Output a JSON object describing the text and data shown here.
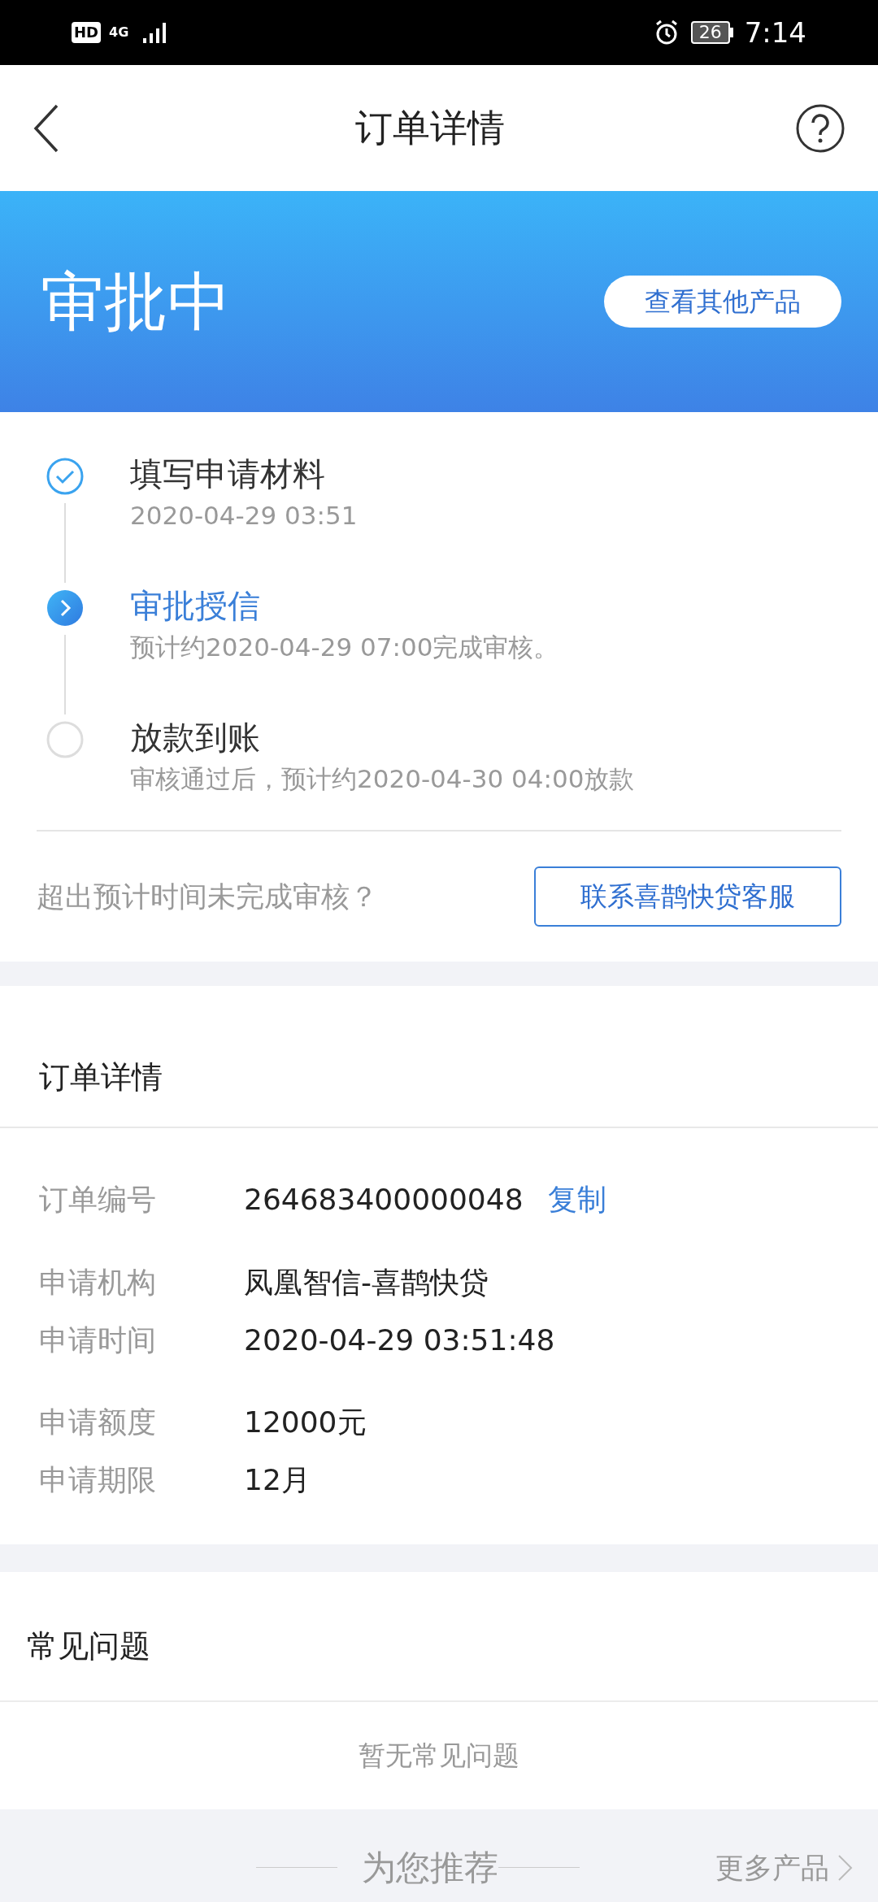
{
  "status_bar": {
    "hd": "HD",
    "network": "4G",
    "battery": "26",
    "time": "7:14"
  },
  "header": {
    "title": "订单详情"
  },
  "banner": {
    "status": "审批中",
    "button": "查看其他产品"
  },
  "steps": [
    {
      "title": "填写申请材料",
      "subtitle": "2020-04-29 03:51",
      "done": true,
      "current": false
    },
    {
      "title": "审批授信",
      "subtitle": "预计约2020-04-29 07:00完成审核。",
      "done": false,
      "current": true
    },
    {
      "title": "放款到账",
      "subtitle": "审核通过后，预计约2020-04-30 04:00放款",
      "done": false,
      "current": false
    }
  ],
  "help": {
    "question": "超出预计时间未完成审核？",
    "button": "联系喜鹊快贷客服"
  },
  "order": {
    "heading": "订单详情",
    "rows": [
      {
        "label": "订单编号",
        "value": "264683400000048",
        "action": "复制"
      },
      {
        "label": "申请机构",
        "value": "凤凰智信-喜鹊快贷"
      },
      {
        "label": "申请时间",
        "value": "2020-04-29 03:51:48"
      },
      {
        "label": "申请额度",
        "value": "12000元"
      },
      {
        "label": "申请期限",
        "value": "12月"
      }
    ]
  },
  "faq": {
    "heading": "常见问题",
    "empty": "暂无常见问题"
  },
  "recommend": {
    "title": "为您推荐",
    "more": "更多产品"
  }
}
